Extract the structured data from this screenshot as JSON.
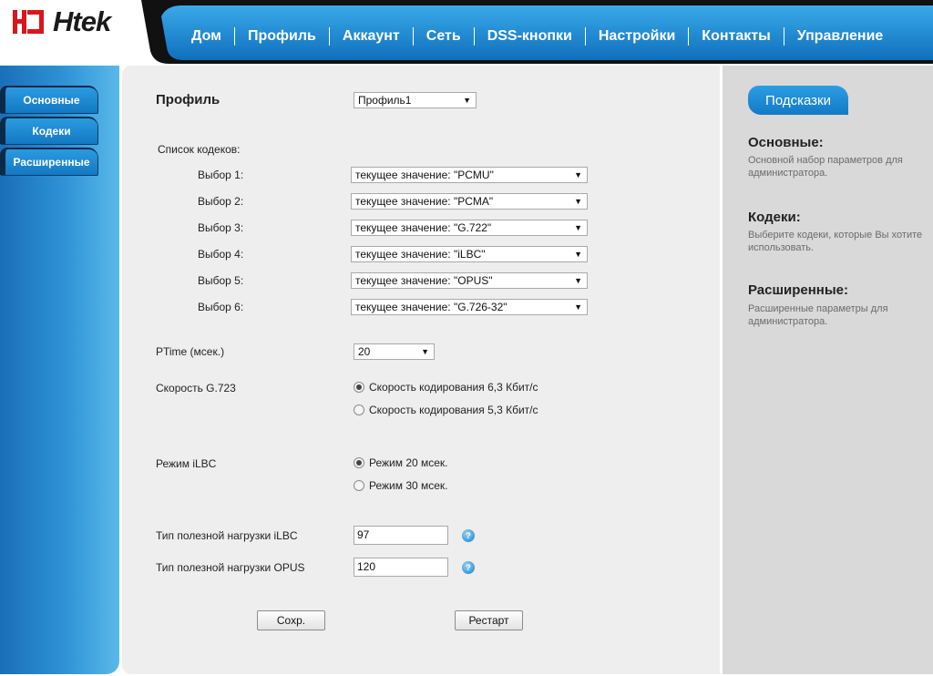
{
  "brand": {
    "logo_text": "Htek",
    "brand_red": "#d7161d"
  },
  "nav": {
    "items": [
      "Дом",
      "Профиль",
      "Аккаунт",
      "Сеть",
      "DSS-кнопки",
      "Настройки",
      "Контакты",
      "Управление"
    ]
  },
  "sidebar": {
    "items": [
      {
        "label": "Основные"
      },
      {
        "label": "Кодеки"
      },
      {
        "label": "Расширенные"
      }
    ]
  },
  "form": {
    "profile_label": "Профиль",
    "profile_value": "Профиль1",
    "codec_list_label": "Список кодеков:",
    "codecs": [
      {
        "label": "Выбор 1:",
        "value": "текущее значение: \"PCMU\""
      },
      {
        "label": "Выбор 2:",
        "value": "текущее значение: \"PCMA\""
      },
      {
        "label": "Выбор 3:",
        "value": "текущее значение: \"G.722\""
      },
      {
        "label": "Выбор 4:",
        "value": "текущее значение: \"iLBC\""
      },
      {
        "label": "Выбор 5:",
        "value": "текущее значение: \"OPUS\""
      },
      {
        "label": "Выбор 6:",
        "value": "текущее значение: \"G.726-32\""
      }
    ],
    "ptime_label": "PTime (мсек.)",
    "ptime_value": "20",
    "g723_label": "Скорость G.723",
    "g723_options": [
      {
        "label": "Скорость кодирования 6,3 Кбит/с",
        "selected": true
      },
      {
        "label": "Скорость кодирования 5,3 Кбит/с",
        "selected": false
      }
    ],
    "ilbc_mode_label": "Режим iLBC",
    "ilbc_mode_options": [
      {
        "label": "Режим 20 мсек.",
        "selected": true
      },
      {
        "label": "Режим 30 мсек.",
        "selected": false
      }
    ],
    "ilbc_payload_label": "Тип полезной нагрузки iLBC",
    "ilbc_payload_value": "97",
    "opus_payload_label": "Тип полезной нагрузки OPUS",
    "opus_payload_value": "120",
    "help_glyph": "?",
    "save_label": "Сохр.",
    "restart_label": "Рестарт"
  },
  "hints": {
    "tab_label": "Подсказки",
    "items": [
      {
        "title": "Основные:",
        "text": "Основной набор параметров для администратора."
      },
      {
        "title": "Кодеки:",
        "text": "Выберите кодеки, которые Вы хотите использовать."
      },
      {
        "title": "Расширенные:",
        "text": "Расширенные параметры для администратора."
      }
    ]
  },
  "icons": {
    "dropdown": "triangle-down",
    "help": "question-circle"
  },
  "colors": {
    "accent_blue": "#1a84d0",
    "hints_bg": "#d9d9d9",
    "content_bg": "#eeeeee"
  }
}
